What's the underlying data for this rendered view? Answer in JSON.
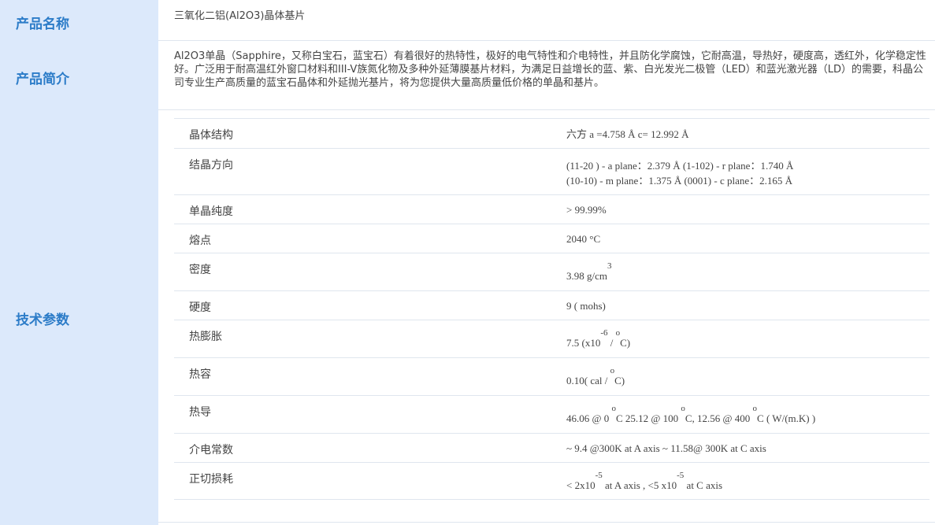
{
  "labels": {
    "product_name": "产品名称",
    "product_intro": "产品简介",
    "tech_params": "技术参数"
  },
  "product": {
    "name": "三氧化二铝(Al2O3)晶体基片",
    "intro": "Al2O3单晶（Sapphire，又称白宝石，蓝宝石）有着很好的热特性，极好的电气特性和介电特性，并且防化学腐蚀，它耐高温，导热好，硬度高，透红外，化学稳定性好。广泛用于耐高温红外窗口材料和III-V族氮化物及多种外延薄膜基片材料，为满足日益增长的蓝、紫、白光发光二极管（LED）和蓝光激光器（LD）的需要，科晶公司专业生产高质量的蓝宝石晶体和外延抛光基片，将为您提供大量高质量低价格的单晶和基片。"
  },
  "params": [
    {
      "key": "晶体结构",
      "value": "六方  a =4.758 Å   c= 12.992 Å"
    },
    {
      "key": "结晶方向",
      "value": "(11-20 ) - a plane：2.379 Å  (1-102) - r plane：1.740 Å",
      "value2": "(10-10) - m plane：1.375 Å  (0001) - c plane：2.165 Å"
    },
    {
      "key": "单晶纯度",
      "value": "> 99.99%"
    },
    {
      "key": "熔点",
      "value": "2040 °C"
    },
    {
      "key": "密度",
      "value_a": "3.98  g/cm",
      "sup_a": "3"
    },
    {
      "key": "硬度",
      "value": "9 ( mohs)"
    },
    {
      "key": "热膨胀",
      "value_a": "7.5 (x10",
      "sup_a": "-6",
      "value_b": " / ",
      "sup_b": "o",
      "value_c": "C)"
    },
    {
      "key": "热容",
      "value_a": "0.10( cal / ",
      "sup_a": "o",
      "value_b": "C)"
    },
    {
      "key": "热导",
      "value_a": "46.06 @ 0 ",
      "sup_a": "o",
      "value_b": "C  25.12 @ 100 ",
      "sup_b": "o",
      "value_c": "C,  12.56 @ 400 ",
      "sup_c": "o",
      "value_d": "C ( W/(m.K) )"
    },
    {
      "key": "介电常数",
      "value": "~ 9.4 @300K  at A axis    ~ 11.58@ 300K at C axis"
    },
    {
      "key": "正切损耗",
      "value_a": "< 2x10",
      "sup_a": "-5",
      "value_b": "  at A axis ,     <5 x10",
      "sup_b": "-5",
      "value_c": "  at C axis"
    }
  ]
}
